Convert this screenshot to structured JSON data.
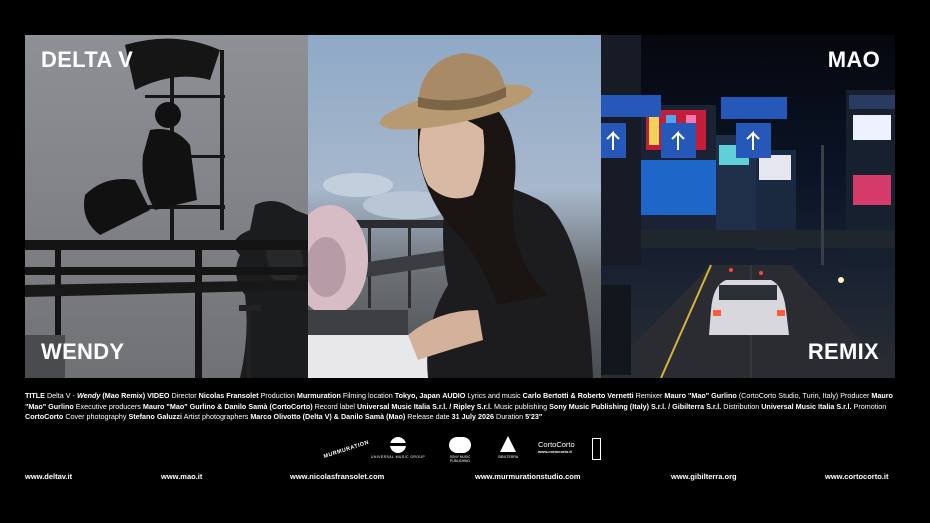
{
  "labels": {
    "top_left": "DELTA V",
    "top_right": "MAO",
    "bottom_left": "WENDY",
    "bottom_right": "REMIX"
  },
  "credits": [
    {
      "k": "TITLE",
      "v": "Delta V - "
    },
    {
      "k": "",
      "v": "Wendy",
      "italic": true
    },
    {
      "k": "",
      "v": " (Mao Remix)  "
    },
    {
      "k": "VIDEO",
      "v": ""
    },
    {
      "k": "",
      "v": " Director ",
      "plain": true
    },
    {
      "k": "Nicolas Fransolet",
      "v": ""
    },
    {
      "k": "",
      "v": "  Production ",
      "plain": true
    },
    {
      "k": "Murmuration",
      "v": ""
    },
    {
      "k": "",
      "v": "  Filming location ",
      "plain": true
    },
    {
      "k": "Tokyo, Japan",
      "v": ""
    },
    {
      "k": "",
      "v": "  ",
      "plain": true
    },
    {
      "k": "AUDIO",
      "v": ""
    },
    {
      "k": "",
      "v": "  Lyrics and music ",
      "plain": true
    },
    {
      "k": "Carlo Bertotti & Roberto Vernetti",
      "v": ""
    },
    {
      "k": "",
      "v": "  Remixer ",
      "plain": true
    },
    {
      "k": "Mauro \"Mao\" Gurlino",
      "v": ""
    },
    {
      "k": "",
      "v": " (CortoCorto Studio, Turin, Italy)  Producer ",
      "plain": true
    },
    {
      "k": "Mauro \"Mao\" Gurlino",
      "v": ""
    },
    {
      "k": "",
      "v": "  Executive producers ",
      "plain": true
    },
    {
      "k": "Mauro \"Mao\" Gurlino & Danilo Samà (CortoCorto)",
      "v": ""
    },
    {
      "k": "",
      "v": "  Record label ",
      "plain": true
    },
    {
      "k": "Universal Music Italia S.r.l. / Ripley S.r.l.",
      "v": ""
    },
    {
      "k": "",
      "v": "  Music publishing ",
      "plain": true
    },
    {
      "k": "Sony Music Publishing (Italy)  S.r.l. / Gibilterra S.r.l.",
      "v": ""
    },
    {
      "k": "",
      "v": "  Distribution  ",
      "plain": true
    },
    {
      "k": "Universal Music Italia S.r.l.",
      "v": ""
    },
    {
      "k": "",
      "v": "  Promotion  ",
      "plain": true
    },
    {
      "k": "CortoCorto",
      "v": ""
    },
    {
      "k": "",
      "v": "  Cover photography  ",
      "plain": true
    },
    {
      "k": "Stefano Galuzzi",
      "v": ""
    },
    {
      "k": "",
      "v": "  Artist photographers  ",
      "plain": true
    },
    {
      "k": "Marco Olivotto (Delta V) & Danilo Samà (Mao)",
      "v": ""
    },
    {
      "k": "",
      "v": "  Release date  ",
      "plain": true
    },
    {
      "k": "31 July 2026",
      "v": ""
    },
    {
      "k": "",
      "v": "   Duration ",
      "plain": true
    },
    {
      "k": "5'23\"",
      "v": ""
    }
  ],
  "logos": {
    "murmuration": "MURMURATION",
    "universal": "UNIVERSAL",
    "universal_sub": "UNIVERSAL MUSIC GROUP",
    "sony": "SONY MUSIC",
    "sony_sub": "PUBLISHING",
    "gibilterra": "GIBILTERRA",
    "cortocorto": "CortoCorto",
    "cortocorto_url": "www.cortocorto.it"
  },
  "websites": [
    "www.deltav.it",
    "www.mao.it",
    "www.nicolasfransolet.com",
    "www.murmurationstudio.com",
    "www.gibilterra.org",
    "www.cortocorto.it"
  ]
}
